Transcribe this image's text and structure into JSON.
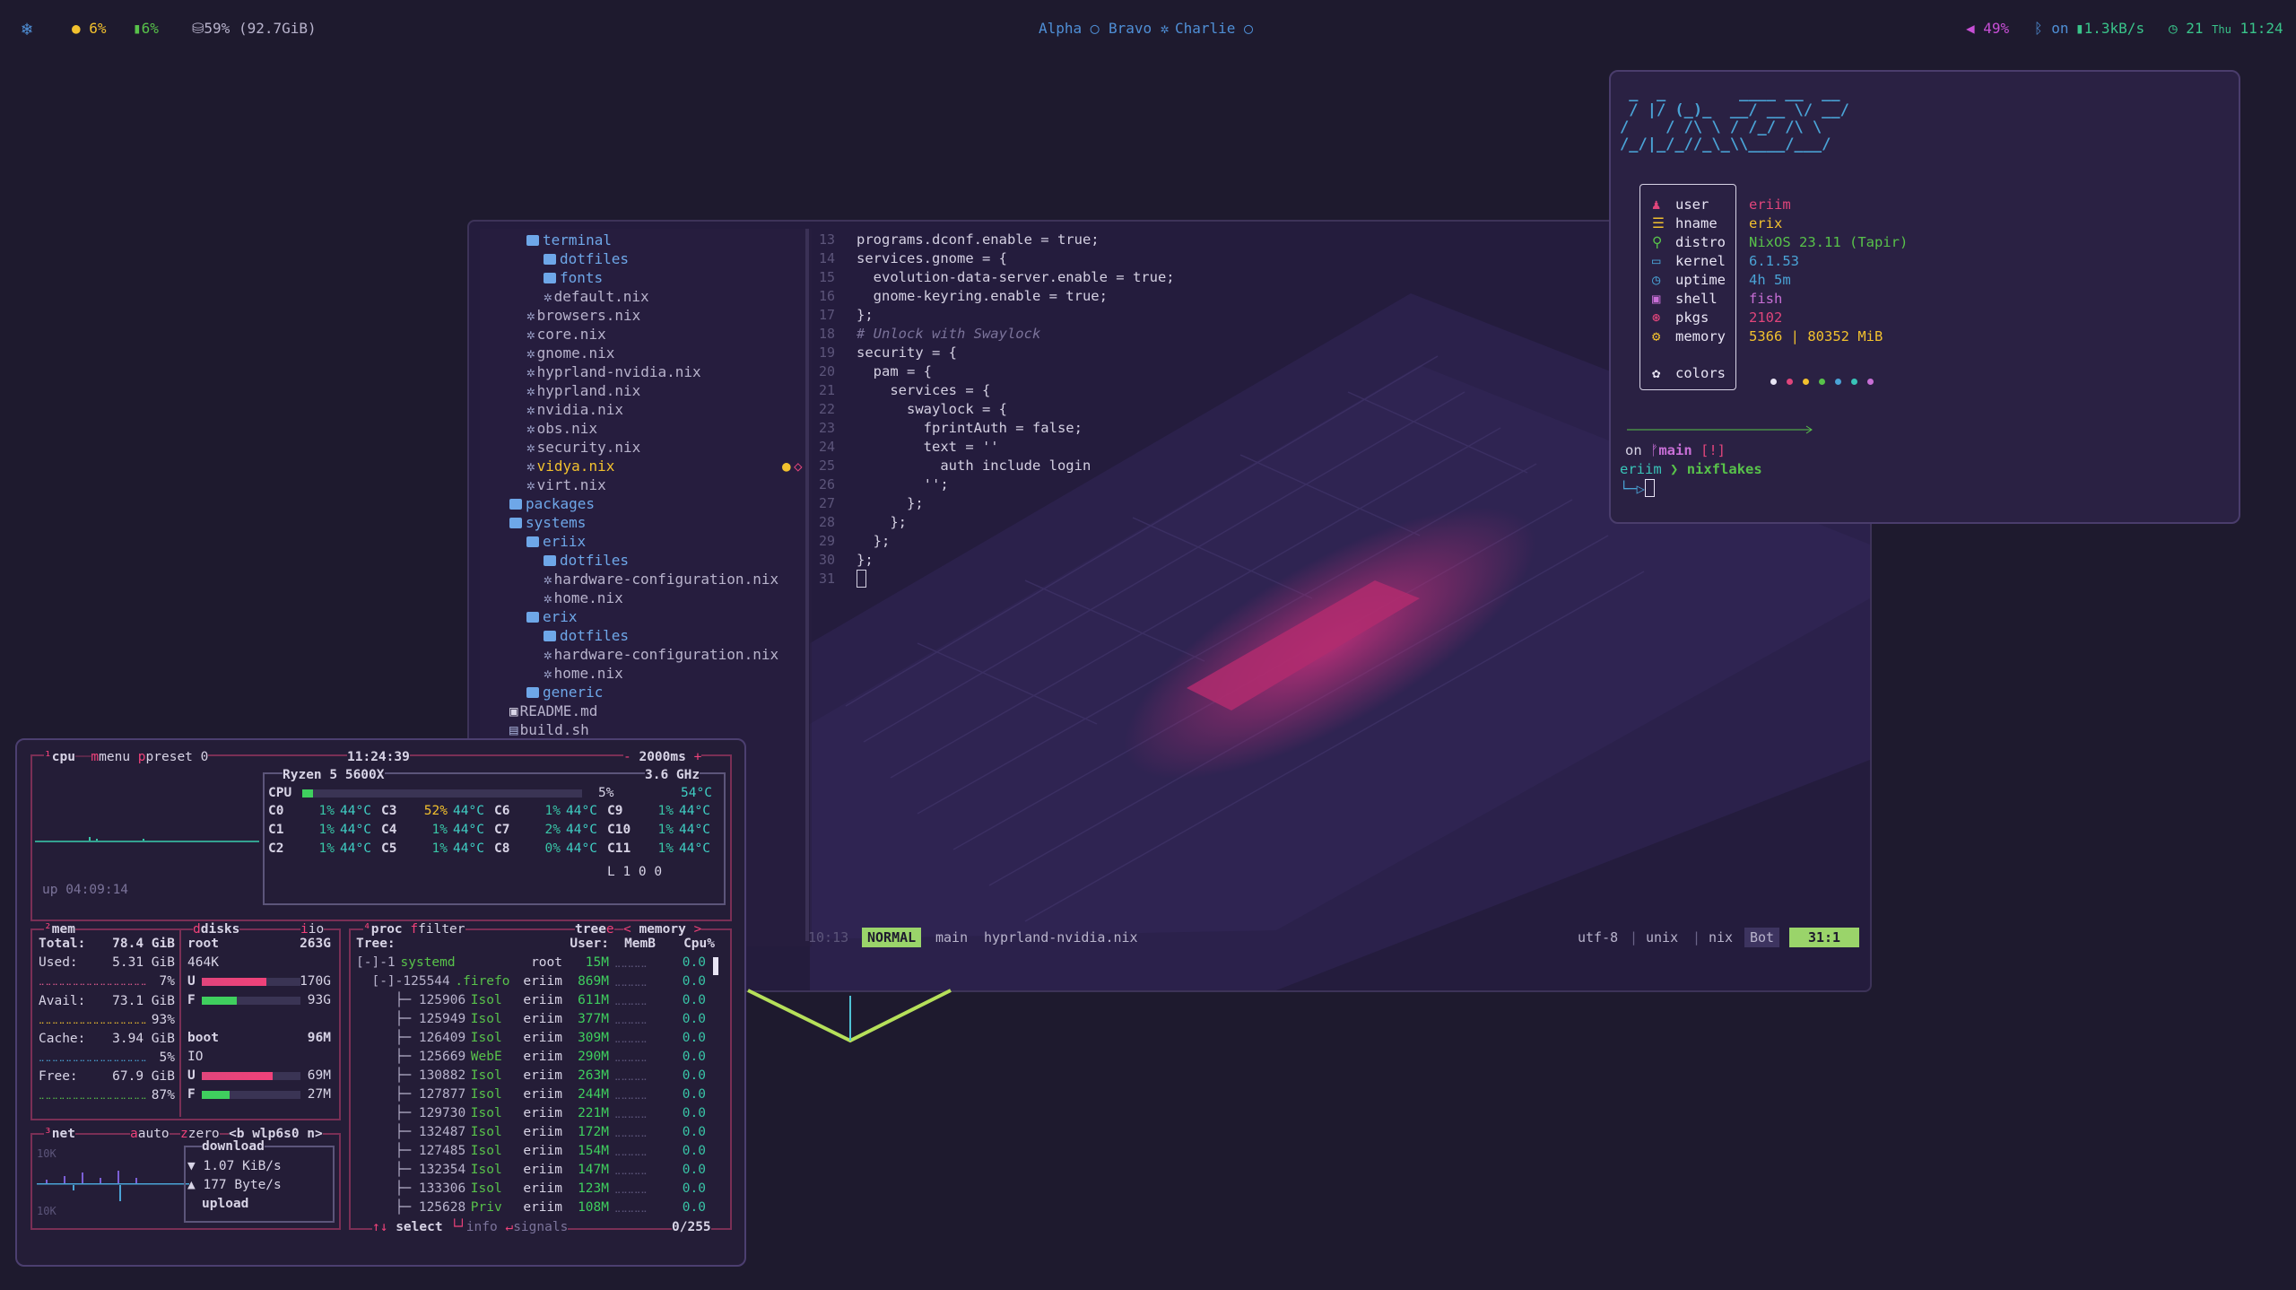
{
  "topbar": {
    "launcher_icon": "nix-snowflake-icon",
    "cpu": "6%",
    "gpu": "6%",
    "disk": "59% (92.7GiB)",
    "workspaces": [
      "Alpha",
      "Bravo",
      "Charlie"
    ],
    "volume": "49%",
    "bluetooth": "on",
    "network": "1.3kB/s",
    "clock": "21",
    "clock_day": "Thu",
    "clock_time": "11:24",
    "colors": {
      "cpu": "#f2c12e",
      "gpu": "#58c24a",
      "workspace": "#4f8fd6",
      "volume": "#c84fd6",
      "network": "#39c48a"
    }
  },
  "editor": {
    "tree": [
      {
        "label": "terminal",
        "type": "folder",
        "depth": 2
      },
      {
        "label": "dotfiles",
        "type": "folder",
        "depth": 3
      },
      {
        "label": "fonts",
        "type": "folder",
        "depth": 3
      },
      {
        "label": "default.nix",
        "type": "file",
        "depth": 3
      },
      {
        "label": "browsers.nix",
        "type": "file",
        "depth": 2
      },
      {
        "label": "core.nix",
        "type": "file",
        "depth": 2
      },
      {
        "label": "gnome.nix",
        "type": "file",
        "depth": 2
      },
      {
        "label": "hyprland-nvidia.nix",
        "type": "file",
        "depth": 2
      },
      {
        "label": "hyprland.nix",
        "type": "file",
        "depth": 2
      },
      {
        "label": "nvidia.nix",
        "type": "file",
        "depth": 2
      },
      {
        "label": "obs.nix",
        "type": "file",
        "depth": 2
      },
      {
        "label": "security.nix",
        "type": "file",
        "depth": 2
      },
      {
        "label": "vidya.nix",
        "type": "file",
        "depth": 2,
        "modified": true
      },
      {
        "label": "virt.nix",
        "type": "file",
        "depth": 2
      },
      {
        "label": "packages",
        "type": "folder",
        "depth": 1
      },
      {
        "label": "systems",
        "type": "folder",
        "depth": 1
      },
      {
        "label": "eriix",
        "type": "folder",
        "depth": 2
      },
      {
        "label": "dotfiles",
        "type": "folder",
        "depth": 3
      },
      {
        "label": "hardware-configuration.nix",
        "type": "file",
        "depth": 3
      },
      {
        "label": "home.nix",
        "type": "file",
        "depth": 3
      },
      {
        "label": "erix",
        "type": "folder",
        "depth": 2
      },
      {
        "label": "dotfiles",
        "type": "folder",
        "depth": 3
      },
      {
        "label": "hardware-configuration.nix",
        "type": "file",
        "depth": 3
      },
      {
        "label": "home.nix",
        "type": "file",
        "depth": 3
      },
      {
        "label": "generic",
        "type": "folder",
        "depth": 2
      },
      {
        "label": "README.md",
        "type": "md",
        "depth": 1
      },
      {
        "label": "build.sh",
        "type": "sh",
        "depth": 1
      },
      {
        "label": "flake.lock",
        "type": "lock",
        "depth": 1
      },
      {
        "label": "flake.nix",
        "type": "file",
        "depth": 1
      }
    ],
    "code": [
      {
        "n": "13",
        "t": "programs.dconf.enable = true;"
      },
      {
        "n": "14",
        "t": "services.gnome = {"
      },
      {
        "n": "15",
        "t": "  evolution-data-server.enable = true;"
      },
      {
        "n": "16",
        "t": "  gnome-keyring.enable = true;"
      },
      {
        "n": "17",
        "t": "};"
      },
      {
        "n": "18",
        "t": "# Unlock with Swaylock"
      },
      {
        "n": "19",
        "t": "security = {"
      },
      {
        "n": "20",
        "t": "  pam = {"
      },
      {
        "n": "21",
        "t": "    services = {"
      },
      {
        "n": "22",
        "t": "      swaylock = {"
      },
      {
        "n": "23",
        "t": "        fprintAuth = false;"
      },
      {
        "n": "24",
        "t": "        text = ''"
      },
      {
        "n": "25",
        "t": "          auth include login"
      },
      {
        "n": "26",
        "t": "        '';"
      },
      {
        "n": "27",
        "t": "      };"
      },
      {
        "n": "28",
        "t": "    };"
      },
      {
        "n": "29",
        "t": "  };"
      },
      {
        "n": "30",
        "t": "};"
      },
      {
        "n": "31",
        "t": ""
      }
    ],
    "status": {
      "time": "10:13",
      "mode": "NORMAL",
      "branch": "main",
      "file": "hyprland-nvidia.nix",
      "encoding": "utf-8",
      "format": "unix",
      "filetype": "nix",
      "position": "Bot",
      "cursor": "31:1"
    }
  },
  "fetch": {
    "logo": [
      " _  _        ____ __  __",
      " / |/ (_)_  __/ __ \\/ __/",
      "/    / /\\ \\ / /_/ /\\ \\  ",
      "/_/|_/_//_\\_\\\\____/___/  "
    ],
    "rows": [
      {
        "icon": "user-icon",
        "key": "user",
        "value": "eriim",
        "color": "#e0457b"
      },
      {
        "icon": "hostname-icon",
        "key": "hname",
        "value": "erix",
        "color": "#f2c12e"
      },
      {
        "icon": "distro-icon",
        "key": "distro",
        "value": "NixOS 23.11 (Tapir)",
        "color": "#58c24a"
      },
      {
        "icon": "kernel-icon",
        "key": "kernel",
        "value": "6.1.53",
        "color": "#4aa3d6"
      },
      {
        "icon": "uptime-icon",
        "key": "uptime",
        "value": "4h 5m",
        "color": "#4aa3d6"
      },
      {
        "icon": "shell-icon",
        "key": "shell",
        "value": "fish",
        "color": "#c86fd6"
      },
      {
        "icon": "pkgs-icon",
        "key": "pkgs",
        "value": "2102",
        "color": "#e0457b"
      },
      {
        "icon": "memory-icon",
        "key": "memory",
        "value": "5366 | 80352 MiB",
        "color": "#f2c12e"
      },
      {
        "icon": "colors-icon",
        "key": "colors",
        "value": "",
        "color": "#e8e4f4"
      }
    ],
    "palette": [
      "#e8e4f4",
      "#e0457b",
      "#f2c12e",
      "#58c24a",
      "#4aa3d6",
      "#39c4b8",
      "#c86fd6"
    ],
    "prompt_on": "on",
    "prompt_branch": "main",
    "prompt_flag": "[!]",
    "prompt_user": "eriim",
    "prompt_dir": "nixflakes"
  },
  "btop": {
    "cpu_box": {
      "title": "cpu",
      "menu": "menu",
      "preset": "preset 0",
      "clock": "11:24:39",
      "rate": "2000ms",
      "uptime": "up 04:09:14"
    },
    "cpu_info": {
      "model": "Ryzen 5 5600X",
      "freq": "3.6 GHz",
      "label": "CPU",
      "total": "5%",
      "temp": "54°C",
      "load": "L 1 0 0"
    },
    "cores": [
      {
        "c": "C0",
        "p": "1%",
        "t": "44°C"
      },
      {
        "c": "C3",
        "p": "52%",
        "t": "44°C"
      },
      {
        "c": "C6",
        "p": "1%",
        "t": "44°C"
      },
      {
        "c": "C9",
        "p": "1%",
        "t": "44°C"
      },
      {
        "c": "C1",
        "p": "1%",
        "t": "44°C"
      },
      {
        "c": "C4",
        "p": "1%",
        "t": "44°C"
      },
      {
        "c": "C7",
        "p": "2%",
        "t": "44°C"
      },
      {
        "c": "C10",
        "p": "1%",
        "t": "44°C"
      },
      {
        "c": "C2",
        "p": "1%",
        "t": "44°C"
      },
      {
        "c": "C5",
        "p": "1%",
        "t": "44°C"
      },
      {
        "c": "C8",
        "p": "0%",
        "t": "44°C"
      },
      {
        "c": "C11",
        "p": "1%",
        "t": "44°C"
      }
    ],
    "mem": {
      "title": "mem",
      "disks": "disks",
      "io": "io",
      "total_label": "Total:",
      "total": "78.4 GiB",
      "used_label": "Used:",
      "used": "5.31 GiB",
      "used_pct": "7%",
      "avail_label": "Avail:",
      "avail": "73.1 GiB",
      "avail_pct": "93%",
      "cache_label": "Cache:",
      "cache": "3.94 GiB",
      "cache_pct": "5%",
      "free_label": "Free:",
      "free": "67.9 GiB",
      "free_pct": "87%"
    },
    "disks": [
      {
        "name": "root",
        "size": "263G",
        "io": "464K",
        "used": "170G",
        "free": "93G",
        "used_frac": 0.65
      },
      {
        "name": "boot",
        "size": "96M",
        "io": "IO",
        "used": "69M",
        "free": "27M",
        "used_frac": 0.72
      }
    ],
    "net": {
      "title": "net",
      "auto": "auto",
      "zero": "zero",
      "iface": "<b wlp6s0 n>",
      "scale_top": "10K",
      "scale_bottom": "10K",
      "download": "download",
      "down_rate": "1.07 KiB/s",
      "up_rate": "177 Byte/s",
      "upload": "upload"
    },
    "proc": {
      "title": "proc",
      "filter": "filter",
      "tree": "tree",
      "sort": "memory",
      "headers": [
        "Tree:",
        "User:",
        "MemB",
        "Cpu%"
      ],
      "rows": [
        {
          "tree": "[-]-1",
          "name": "systemd",
          "user": "root",
          "mem": "15M",
          "cpu": "0.0"
        },
        {
          "tree": "  [-]-125544",
          "name": ".firefo",
          "user": "eriim",
          "mem": "869M",
          "cpu": "0.0"
        },
        {
          "tree": "     ├─ 125906",
          "name": "Isol",
          "user": "eriim",
          "mem": "611M",
          "cpu": "0.0"
        },
        {
          "tree": "     ├─ 125949",
          "name": "Isol",
          "user": "eriim",
          "mem": "377M",
          "cpu": "0.0"
        },
        {
          "tree": "     ├─ 126409",
          "name": "Isol",
          "user": "eriim",
          "mem": "309M",
          "cpu": "0.0"
        },
        {
          "tree": "     ├─ 125669",
          "name": "WebE",
          "user": "eriim",
          "mem": "290M",
          "cpu": "0.0"
        },
        {
          "tree": "     ├─ 130882",
          "name": "Isol",
          "user": "eriim",
          "mem": "263M",
          "cpu": "0.0"
        },
        {
          "tree": "     ├─ 127877",
          "name": "Isol",
          "user": "eriim",
          "mem": "244M",
          "cpu": "0.0"
        },
        {
          "tree": "     ├─ 129730",
          "name": "Isol",
          "user": "eriim",
          "mem": "221M",
          "cpu": "0.0"
        },
        {
          "tree": "     ├─ 132487",
          "name": "Isol",
          "user": "eriim",
          "mem": "172M",
          "cpu": "0.0"
        },
        {
          "tree": "     ├─ 127485",
          "name": "Isol",
          "user": "eriim",
          "mem": "154M",
          "cpu": "0.0"
        },
        {
          "tree": "     ├─ 132354",
          "name": "Isol",
          "user": "eriim",
          "mem": "147M",
          "cpu": "0.0"
        },
        {
          "tree": "     ├─ 133306",
          "name": "Isol",
          "user": "eriim",
          "mem": "123M",
          "cpu": "0.0"
        },
        {
          "tree": "     ├─ 125628",
          "name": "Priv",
          "user": "eriim",
          "mem": "108M",
          "cpu": "0.0"
        }
      ],
      "select": "select",
      "info": "info",
      "signals": "signals",
      "count": "0/255"
    }
  }
}
